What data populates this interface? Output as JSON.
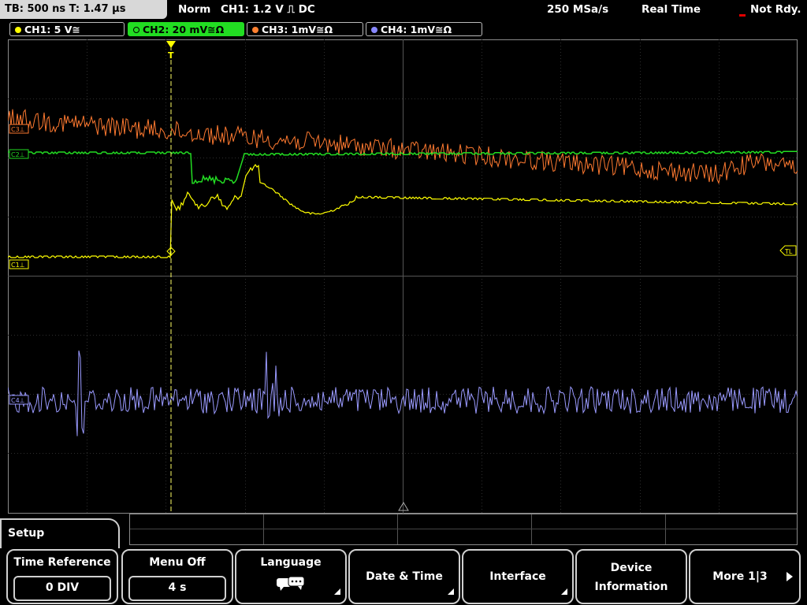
{
  "status_bar": {
    "timebase": "TB: 500 ns   T: 1.47 µs",
    "mode": "Norm",
    "trigger": "CH1: 1.2 V ⎍ DC",
    "sample_rate": "250 MSa/s",
    "acq_mode": "Real Time",
    "state": "Not Rdy."
  },
  "channels": [
    {
      "label": "CH1: 5 V≅",
      "color": "#ffff00",
      "active": false
    },
    {
      "label": "CH2: 20 mV≅Ω",
      "color": "#22dd22",
      "active": true
    },
    {
      "label": "CH3: 1mV≅Ω",
      "color": "#ff8030",
      "active": false
    },
    {
      "label": "CH4: 1mV≅Ω",
      "color": "#8888ff",
      "active": false
    }
  ],
  "markers": {
    "ch1": "C1⊥",
    "ch2": "C2⊥",
    "ch3": "C3⊥",
    "ch4": "C4⊥",
    "trigger_level": "TL",
    "trigger_pos": "T"
  },
  "colors": {
    "ch1": "#ffff00",
    "ch2": "#22dd22",
    "ch3": "#ff7a30",
    "ch4": "#9a9aff",
    "grid": "#3a3a3a"
  },
  "menu": {
    "setup": "Setup",
    "softkeys": [
      {
        "label": "Time Reference",
        "value": "0 DIV"
      },
      {
        "label": "Menu Off",
        "value": "4 s"
      },
      {
        "label": "Language",
        "icon": "speech-bubble-icon"
      },
      {
        "label": "Date & Time"
      },
      {
        "label": "Interface"
      },
      {
        "label_line1": "Device",
        "label_line2": "Information"
      },
      {
        "label": "More 1|3"
      }
    ]
  }
}
